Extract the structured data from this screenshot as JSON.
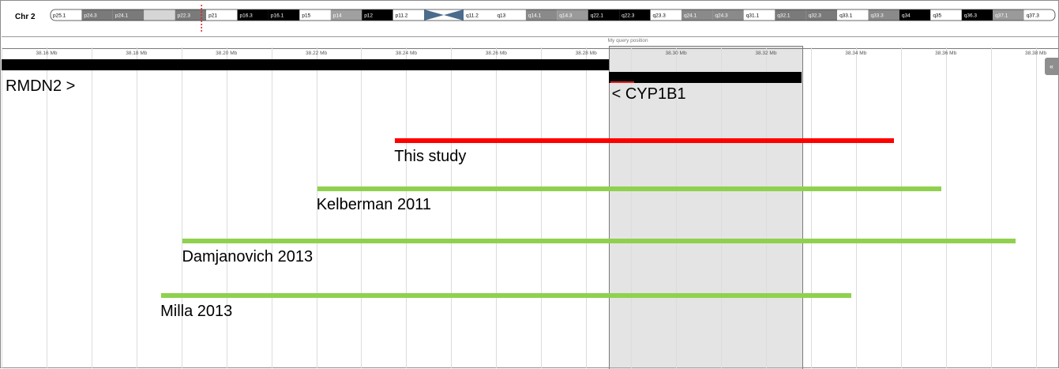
{
  "chromosome": {
    "label": "Chr 2"
  },
  "ideogram_bands": [
    {
      "name": "p25.1",
      "color": "#ffffff",
      "text": "#000000"
    },
    {
      "name": "p24.3",
      "color": "#7a7a7a",
      "text": "#ffffff"
    },
    {
      "name": "p24.1",
      "color": "#7a7a7a",
      "text": "#ffffff"
    },
    {
      "name": "",
      "color": "#d6d6d6",
      "text": "#000000"
    },
    {
      "name": "p22.3",
      "color": "#7a7a7a",
      "text": "#ffffff"
    },
    {
      "name": "p21",
      "color": "#ffffff",
      "text": "#000000"
    },
    {
      "name": "p16.3",
      "color": "#000000",
      "text": "#ffffff"
    },
    {
      "name": "p16.1",
      "color": "#000000",
      "text": "#ffffff"
    },
    {
      "name": "p15",
      "color": "#ffffff",
      "text": "#000000"
    },
    {
      "name": "p14",
      "color": "#a0a0a0",
      "text": "#ffffff"
    },
    {
      "name": "p12",
      "color": "#000000",
      "text": "#ffffff"
    },
    {
      "name": "p11.2",
      "color": "#ffffff",
      "text": "#000000"
    },
    {
      "name": "q11.2",
      "color": "#ffffff",
      "text": "#000000"
    },
    {
      "name": "q13",
      "color": "#ffffff",
      "text": "#000000"
    },
    {
      "name": "q14.1",
      "color": "#8a8a8a",
      "text": "#ffffff"
    },
    {
      "name": "q14.3",
      "color": "#9a9a9a",
      "text": "#ffffff"
    },
    {
      "name": "q22.1",
      "color": "#000000",
      "text": "#ffffff"
    },
    {
      "name": "q22.3",
      "color": "#000000",
      "text": "#ffffff"
    },
    {
      "name": "q23.3",
      "color": "#ffffff",
      "text": "#000000"
    },
    {
      "name": "q24.1",
      "color": "#8a8a8a",
      "text": "#ffffff"
    },
    {
      "name": "q24.3",
      "color": "#8a8a8a",
      "text": "#ffffff"
    },
    {
      "name": "q31.1",
      "color": "#ffffff",
      "text": "#000000"
    },
    {
      "name": "q32.1",
      "color": "#7a7a7a",
      "text": "#ffffff"
    },
    {
      "name": "q32.3",
      "color": "#7a7a7a",
      "text": "#ffffff"
    },
    {
      "name": "q33.1",
      "color": "#ffffff",
      "text": "#000000"
    },
    {
      "name": "q33.3",
      "color": "#8a8a8a",
      "text": "#ffffff"
    },
    {
      "name": "q34",
      "color": "#000000",
      "text": "#ffffff"
    },
    {
      "name": "q35",
      "color": "#ffffff",
      "text": "#000000"
    },
    {
      "name": "q36.3",
      "color": "#000000",
      "text": "#ffffff"
    },
    {
      "name": "q37.1",
      "color": "#9a9a9a",
      "text": "#ffffff"
    },
    {
      "name": "q37.3",
      "color": "#ffffff",
      "text": "#000000"
    }
  ],
  "ruler": {
    "unit": "Mb",
    "ticks": [
      "38.16 Mb",
      "38.18 Mb",
      "38.20 Mb",
      "38.22 Mb",
      "38.24 Mb",
      "38.26 Mb",
      "38.28 Mb",
      "38.30 Mb",
      "38.32 Mb",
      "38.34 Mb",
      "38.36 Mb",
      "38.38 Mb"
    ],
    "range_mb": [
      38.15,
      38.385
    ]
  },
  "query": {
    "label": "My query position",
    "start_mb": 38.285,
    "end_mb": 38.328
  },
  "genes": [
    {
      "label": "RMDN2 >",
      "start_mb": 38.15,
      "end_mb": 38.285
    },
    {
      "label": "< CYP1B1",
      "start_mb": 38.285,
      "end_mb": 38.328
    }
  ],
  "segments": [
    {
      "label": "This study",
      "start_mb": 38.2375,
      "end_mb": 38.3485,
      "color": "#ff0000"
    },
    {
      "label": "Kelberman 2011",
      "start_mb": 38.2202,
      "end_mb": 38.359,
      "color": "#8fd14f"
    },
    {
      "label": "Damjanovich 2013",
      "start_mb": 38.1903,
      "end_mb": 38.3755,
      "color": "#8fd14f"
    },
    {
      "label": "Milla 2013",
      "start_mb": 38.1855,
      "end_mb": 38.339,
      "color": "#8fd14f"
    }
  ],
  "ui": {
    "collapse_glyph": "«"
  }
}
